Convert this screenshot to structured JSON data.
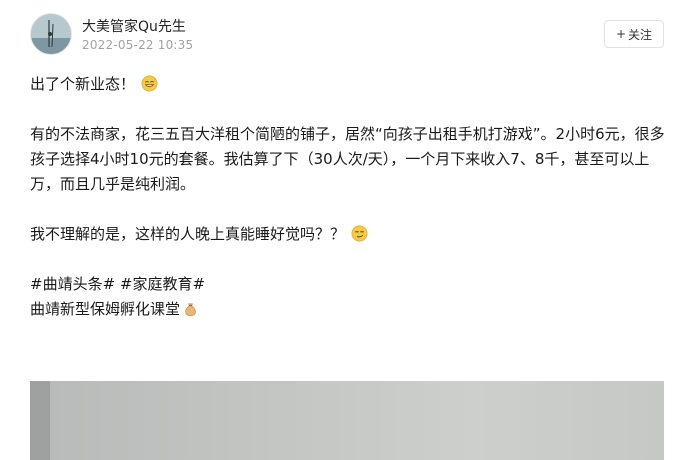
{
  "author": {
    "name": "大美管家Qu先生",
    "time": "2022-05-22 10:35"
  },
  "follow_button": {
    "icon": "+",
    "label": "关注"
  },
  "post": {
    "line1": "出了个新业态！",
    "line1_emoji": "grin-sweat-emoji",
    "para2": "有的不法商家，花三五百大洋租个简陋的铺子，居然“向孩子出租手机打游戏”。2小时6元，很多孩子选择4小时10元的套餐。我估算了下（30人次/天），一个月下来收入7、8千，甚至可以上万，而且几乎是纯利润。",
    "para3": "我不理解的是，这样的人晚上真能睡好觉吗？？",
    "para3_emoji": "smirk-emoji",
    "hashtags": "#曲靖头条# #家庭教育#",
    "footer_line": "曲靖新型保姆孵化课堂",
    "footer_emoji": "money-bag-emoji"
  }
}
